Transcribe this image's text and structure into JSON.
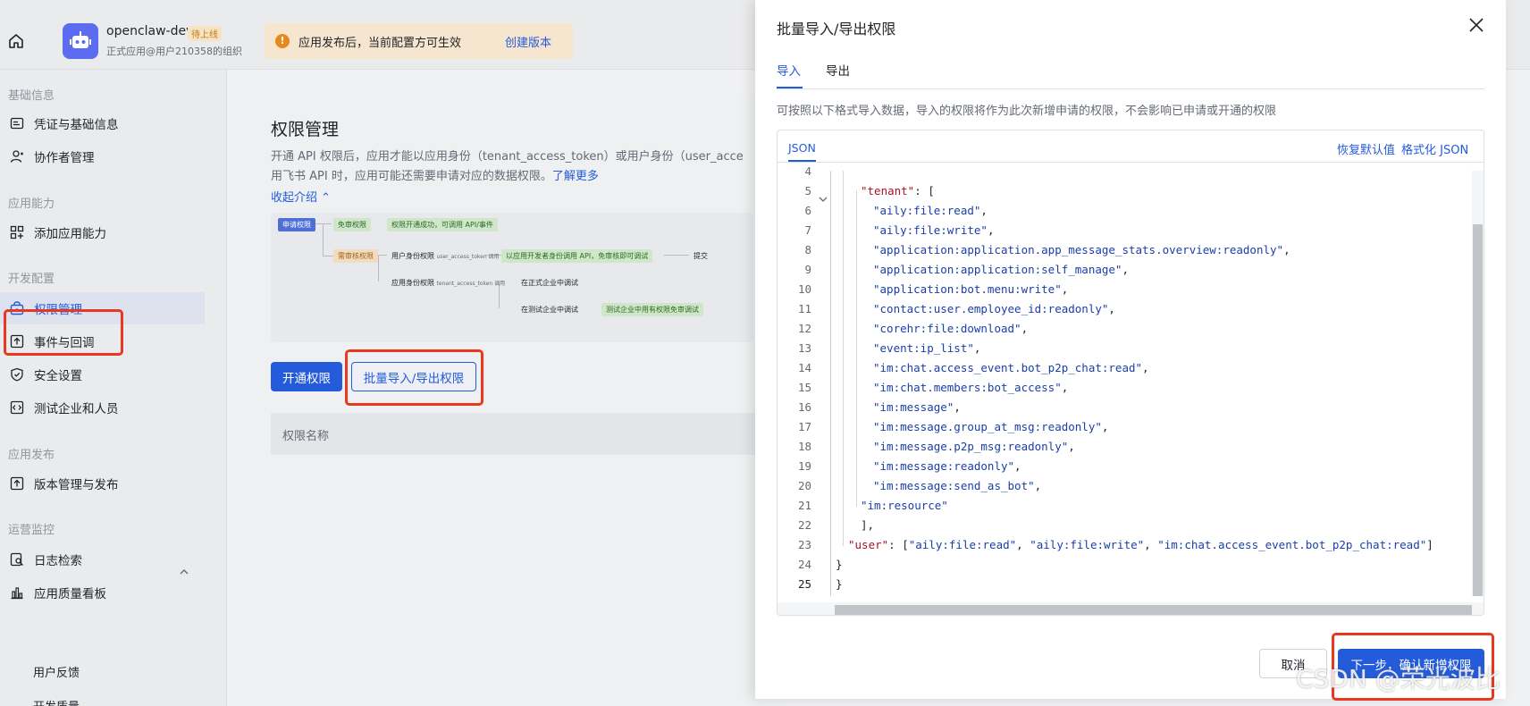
{
  "topbar": {
    "app_name": "openclaw-dev",
    "app_status": "待上线",
    "app_org": "正式应用@用户210358的组织",
    "notice_text": "应用发布后，当前配置方可生效",
    "notice_link": "创建版本"
  },
  "sidebar": {
    "groups": [
      "基础信息",
      "应用能力",
      "开发配置",
      "应用发布",
      "运营监控"
    ],
    "items": [
      {
        "label": "凭证与基础信息",
        "icon": "id-card-icon"
      },
      {
        "label": "协作者管理",
        "icon": "user-add-icon"
      },
      {
        "label": "添加应用能力",
        "icon": "grid-plus-icon"
      },
      {
        "label": "权限管理",
        "icon": "lock-box-icon",
        "active": true
      },
      {
        "label": "事件与回调",
        "icon": "upload-box-icon"
      },
      {
        "label": "安全设置",
        "icon": "shield-check-icon"
      },
      {
        "label": "测试企业和人员",
        "icon": "code-box-icon"
      },
      {
        "label": "版本管理与发布",
        "icon": "upload-box-icon"
      },
      {
        "label": "日志检索",
        "icon": "search-doc-icon"
      },
      {
        "label": "应用质量看板",
        "icon": "bar-chart-icon"
      }
    ],
    "sub_items": [
      "用户反馈",
      "开发质量"
    ]
  },
  "main": {
    "title": "权限管理",
    "desc_line1": "开通 API 权限后，应用才能以应用身份（tenant_access_token）或用户身份（user_acce",
    "desc_line2": "用飞书 API 时，应用可能还需要申请对应的数据权限。",
    "learn_more": "了解更多",
    "collapse": "收起介绍",
    "flow": {
      "apply": "申请权限",
      "free": "免审权限",
      "free_result": "权限开通成功，可调用 API/事件",
      "review": "需审核权限",
      "user_identity": "用户身份权限",
      "user_token": "user_access_token 调用",
      "dev_call": "以应用开发者身份调用 API，免审核即可调试",
      "submit": "提交",
      "app_identity": "应用身份权限",
      "tenant_token": "tenant_access_token 调用",
      "formal_debug": "在正式企业中调试",
      "test_debug": "在测试企业中调试",
      "test_result": "测试企业中用有权限免审调试"
    },
    "btn_open": "开通权限",
    "btn_batch": "批量导入/导出权限",
    "table_col": "权限名称"
  },
  "drawer": {
    "title": "批量导入/导出权限",
    "tabs": [
      "导入",
      "导出"
    ],
    "hint": "可按照以下格式导入数据，导入的权限将作为此次新增申请的权限，不会影响已申请或开通的权限",
    "editor_tab": "JSON",
    "restore": "恢复默认值",
    "format": "格式化 JSON",
    "lines": [
      {
        "n": "4",
        "t": ""
      },
      {
        "n": "5",
        "t": "\"tenant\": ["
      },
      {
        "n": "6",
        "t": "\"aily:file:read\","
      },
      {
        "n": "7",
        "t": "\"aily:file:write\","
      },
      {
        "n": "8",
        "t": "\"application:application.app_message_stats.overview:readonly\","
      },
      {
        "n": "9",
        "t": "\"application:application:self_manage\","
      },
      {
        "n": "10",
        "t": "\"application:bot.menu:write\","
      },
      {
        "n": "11",
        "t": "\"contact:user.employee_id:readonly\","
      },
      {
        "n": "12",
        "t": "\"corehr:file:download\","
      },
      {
        "n": "13",
        "t": "\"event:ip_list\","
      },
      {
        "n": "14",
        "t": "\"im:chat.access_event.bot_p2p_chat:read\","
      },
      {
        "n": "15",
        "t": "\"im:chat.members:bot_access\","
      },
      {
        "n": "16",
        "t": "\"im:message\","
      },
      {
        "n": "17",
        "t": "\"im:message.group_at_msg:readonly\","
      },
      {
        "n": "18",
        "t": "\"im:message.p2p_msg:readonly\","
      },
      {
        "n": "19",
        "t": "\"im:message:readonly\","
      },
      {
        "n": "20",
        "t": "\"im:message:send_as_bot\","
      },
      {
        "n": "21",
        "t": "\"im:resource\""
      },
      {
        "n": "22",
        "t": "],"
      },
      {
        "n": "23",
        "t": "\"user\": [\"aily:file:read\", \"aily:file:write\", \"im:chat.access_event.bot_p2p_chat:read\"]"
      },
      {
        "n": "24",
        "t": "}"
      },
      {
        "n": "25",
        "t": "}"
      }
    ],
    "btn_cancel": "取消",
    "btn_next": "下一步，确认新增权限"
  },
  "watermark": "CSDN @荣光波比",
  "colors": {
    "accent": "#245bdb",
    "highlight": "#e8381f"
  }
}
